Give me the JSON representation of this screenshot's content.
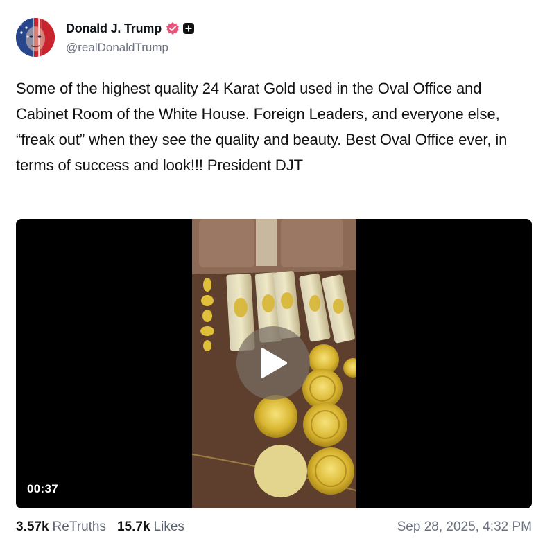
{
  "author": {
    "display_name": "Donald J. Trump",
    "handle": "@realDonaldTrump",
    "verified_icon": "verified-badge-icon",
    "plus_icon": "plus-badge-icon",
    "verified_color": "#e4567b"
  },
  "post": {
    "text": "Some of the highest quality 24 Karat Gold used in the Oval Office and Cabinet Room of the White House. Foreign Leaders, and everyone else, “freak out” when they see the quality and beauty. Best Oval Office ever, in terms of success and look!!! President DJT"
  },
  "video": {
    "duration": "00:37",
    "play_icon": "play-icon"
  },
  "stats": {
    "retruths_count": "3.57k",
    "retruths_label": "ReTruths",
    "likes_count": "15.7k",
    "likes_label": "Likes",
    "timestamp": "Sep 28, 2025, 4:32 PM"
  }
}
